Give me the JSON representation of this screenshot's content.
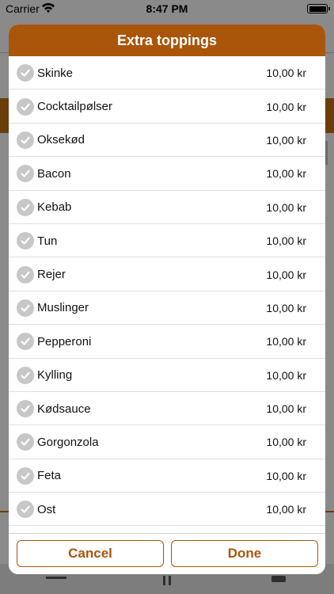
{
  "status_bar": {
    "carrier": "Carrier",
    "time": "8:47 PM",
    "wifi_icon": "wifi-icon",
    "battery_icon": "battery-icon"
  },
  "modal": {
    "title": "Extra toppings",
    "items": [
      {
        "name": "Skinke",
        "price": "10,00 kr"
      },
      {
        "name": "Cocktailpølser",
        "price": "10,00 kr"
      },
      {
        "name": "Oksekød",
        "price": "10,00 kr"
      },
      {
        "name": "Bacon",
        "price": "10,00 kr"
      },
      {
        "name": "Kebab",
        "price": "10,00 kr"
      },
      {
        "name": "Tun",
        "price": "10,00 kr"
      },
      {
        "name": "Rejer",
        "price": "10,00 kr"
      },
      {
        "name": "Muslinger",
        "price": "10,00 kr"
      },
      {
        "name": "Pepperoni",
        "price": "10,00 kr"
      },
      {
        "name": "Kylling",
        "price": "10,00 kr"
      },
      {
        "name": "Kødsauce",
        "price": "10,00 kr"
      },
      {
        "name": "Gorgonzola",
        "price": "10,00 kr"
      },
      {
        "name": "Feta",
        "price": "10,00 kr"
      },
      {
        "name": "Ost",
        "price": "10,00 kr"
      },
      {
        "name": "",
        "price": ""
      }
    ],
    "cancel_label": "Cancel",
    "done_label": "Done"
  },
  "colors": {
    "accent": "#a9560b",
    "check": "#c7c7c7"
  }
}
